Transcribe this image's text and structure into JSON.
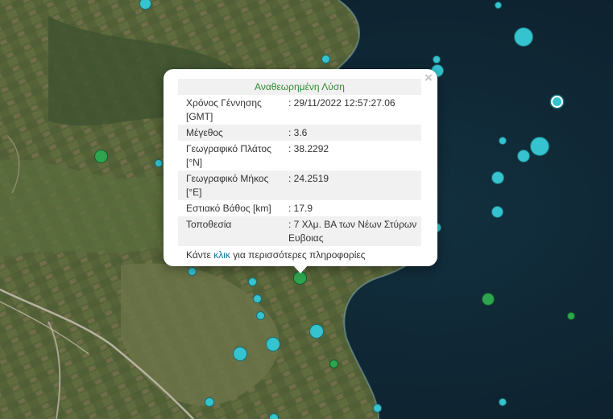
{
  "popup": {
    "title": "Αναθεωρημένη Λύση",
    "rows": [
      {
        "label": "Χρόνος Γέννησης [GMT]",
        "value": ": 29/11/2022 12:57:27.06"
      },
      {
        "label": "Μέγεθος",
        "value": ": 3.6"
      },
      {
        "label": "Γεωγραφικό Πλάτος [°N]",
        "value": ": 38.2292"
      },
      {
        "label": "Γεωγραφικό Μήκος [°E]",
        "value": ": 24.2519"
      },
      {
        "label": "Εστιακό Βάθος [km]",
        "value": ": 17.9"
      },
      {
        "label": "Τοποθεσία",
        "value": ": 7 Χλμ. ΒΑ των Νέων Στύρων Ευβοιας"
      }
    ],
    "more": {
      "prefix": "Κάντε ",
      "link": "κλικ",
      "suffix": " για περισσότερες πληροφορίες"
    },
    "close_glyph": "×"
  },
  "colors": {
    "recent_marker": "#34c3cf",
    "selected_marker": "#2fa44f",
    "sea": "#0f2230"
  }
}
